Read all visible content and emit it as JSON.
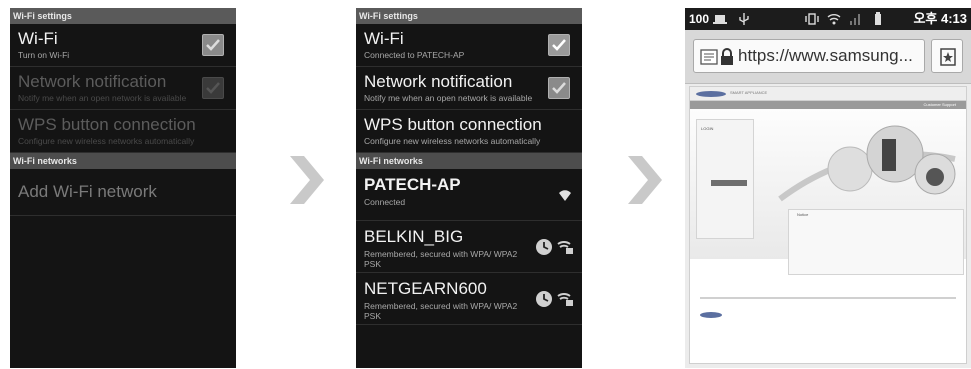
{
  "screen1": {
    "section_settings": "Wi-Fi settings",
    "items": [
      {
        "title": "Wi-Fi",
        "subtitle": "Turn on Wi-Fi",
        "checked": true
      },
      {
        "title": "Network notification",
        "subtitle": "Notify me when an open network is available",
        "checked": true
      },
      {
        "title": "WPS button connection",
        "subtitle": "Configure new wireless networks automatically"
      }
    ],
    "section_networks": "Wi-Fi networks",
    "add_network": "Add Wi-Fi network"
  },
  "screen2": {
    "section_settings": "Wi-Fi settings",
    "items": [
      {
        "title": "Wi-Fi",
        "subtitle": "Connected to PATECH-AP",
        "checked": true
      },
      {
        "title": "Network notification",
        "subtitle": "Notify me when an open network is available",
        "checked": true
      },
      {
        "title": "WPS button connection",
        "subtitle": "Configure new wireless networks automatically"
      }
    ],
    "section_networks": "Wi-Fi networks",
    "networks": [
      {
        "name": "PATECH-AP",
        "status": "Connected"
      },
      {
        "name": "BELKIN_BIG",
        "status": "Remembered, secured with WPA/ WPA2 PSK"
      },
      {
        "name": "NETGEARN600",
        "status": "Remembered, secured with WPA/ WPA2 PSK"
      }
    ]
  },
  "screen3": {
    "status": {
      "battery": "100",
      "time": "오후 4:13"
    },
    "url": "https://www.samsung...",
    "webpage": {
      "brand": "SMART APPLIANCE",
      "nav": "Customer Support",
      "login": "LOGIN",
      "notice": "Notice"
    }
  },
  "icons": [
    "checkbox-check-icon",
    "wifi-signal-icon",
    "remembered-icon",
    "wifi-secured-icon",
    "chevron-right-icon",
    "page-icon",
    "lock-icon",
    "bookmark-icon",
    "usb-icon",
    "vibrate-icon",
    "signal-icon",
    "battery-icon"
  ],
  "colors": {
    "screen_bg": "#141414",
    "section_bg": "#4d4d4d",
    "text": "#f2f2f2",
    "subtext": "#a8a8a8",
    "chevron": "#c9c9c9"
  }
}
